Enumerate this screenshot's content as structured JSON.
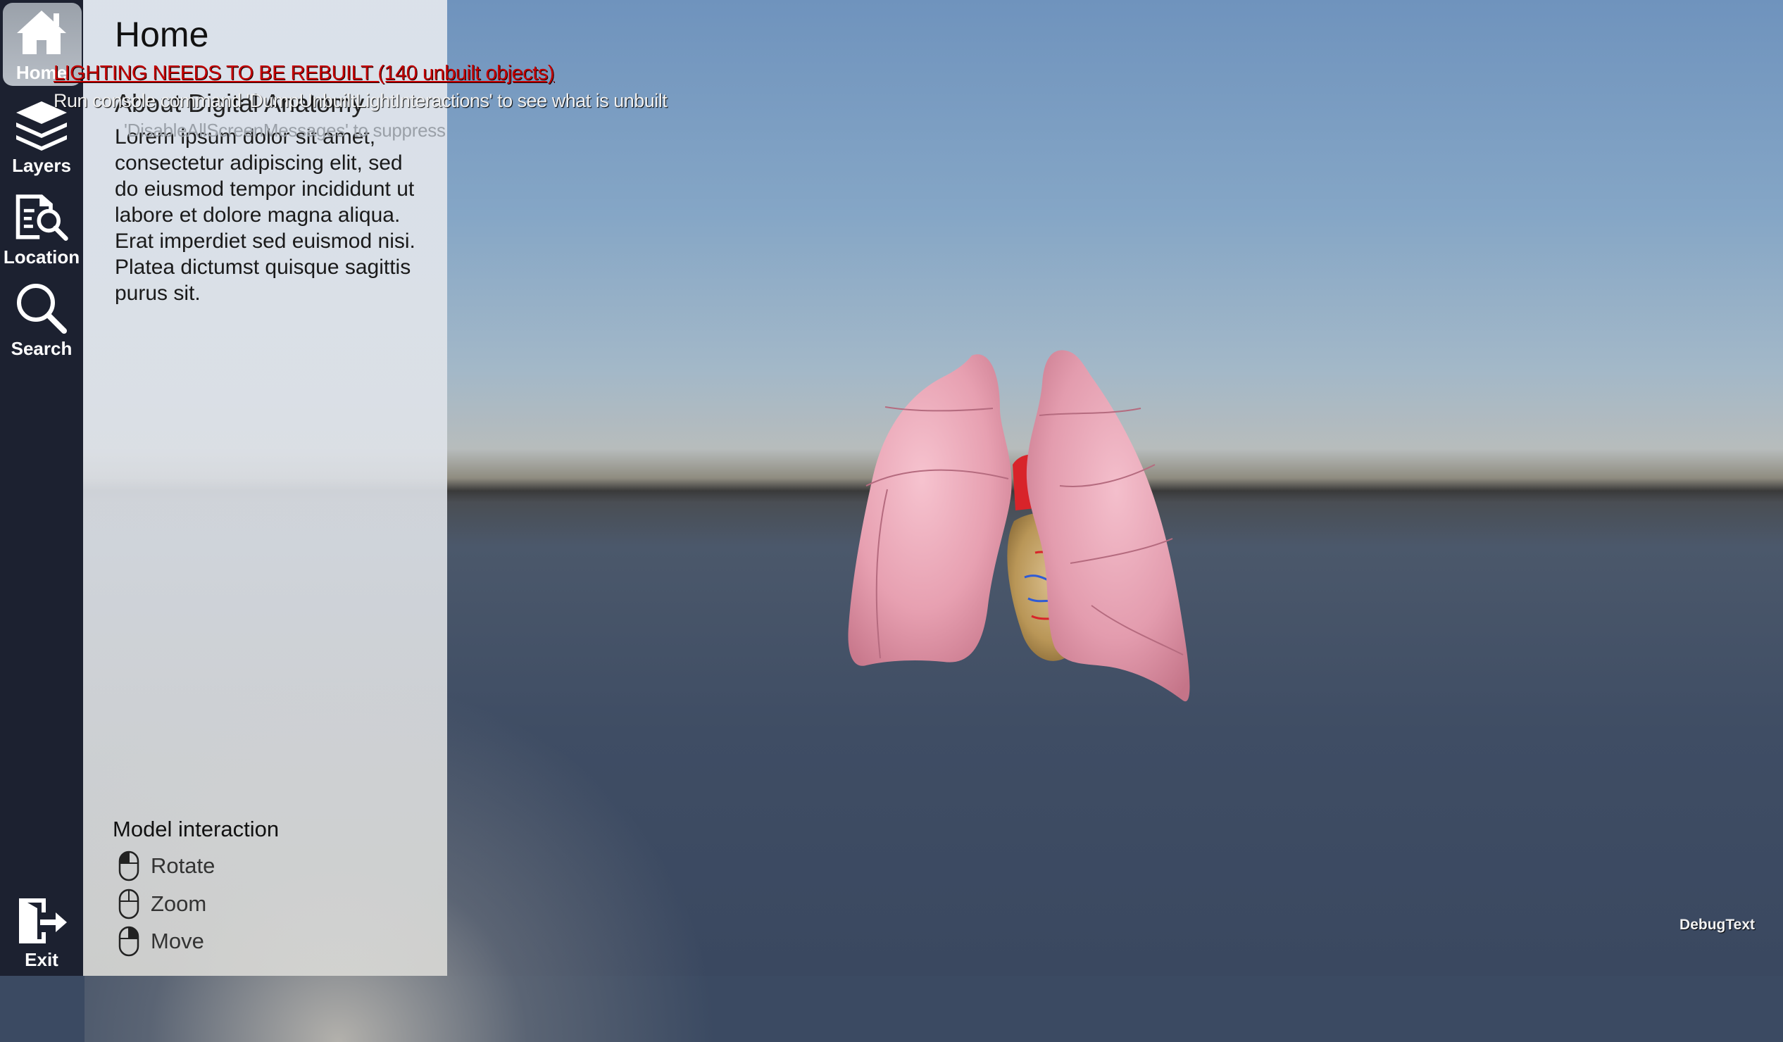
{
  "rail": {
    "items": [
      {
        "label": "Home",
        "icon": "home-icon",
        "active": true
      },
      {
        "label": "Layers",
        "icon": "layers-icon",
        "active": false
      },
      {
        "label": "Location",
        "icon": "location-search-icon",
        "active": false
      },
      {
        "label": "Search",
        "icon": "search-icon",
        "active": false
      }
    ],
    "exit_label": "Exit"
  },
  "panel": {
    "title": "Home",
    "subtitle": "About Digital Anatomy",
    "body": "Lorem ipsum dolor sit amet, consectetur adipiscing elit, sed do eiusmod tempor incididunt ut labore et dolore magna aliqua. Erat imperdiet sed euismod nisi. Platea dictumst quisque sagittis purus sit.",
    "interaction": {
      "title": "Model interaction",
      "items": [
        {
          "label": "Rotate",
          "icon": "mouse-left-click-icon"
        },
        {
          "label": "Zoom",
          "icon": "mouse-scroll-icon"
        },
        {
          "label": "Move",
          "icon": "mouse-right-click-icon"
        }
      ]
    }
  },
  "overlay": {
    "warning": "LIGHTING NEEDS TO BE REBUILT (140 unbuilt objects)",
    "console_hint": "Run console command 'DumpUnbuiltLightInteractions' to see what is unbuilt",
    "suppress_hint": "'DisableAllScreenMessages' to suppress",
    "debug_text": "DebugText"
  },
  "colors": {
    "rail_bg": "#1c2130",
    "warning": "#c40000",
    "lung": "#e9a3b3",
    "heart": "#c9a76b",
    "aorta": "#d8242a"
  }
}
